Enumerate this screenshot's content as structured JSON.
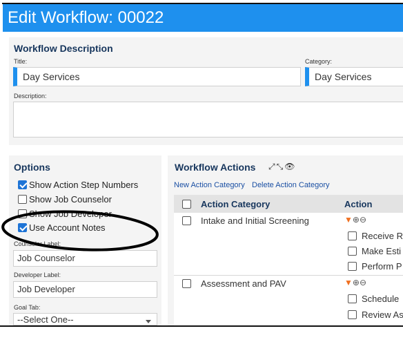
{
  "header": {
    "title": "Edit Workflow: 00022"
  },
  "workflow_description": {
    "heading": "Workflow Description",
    "title_label": "Title:",
    "title_value": "Day Services",
    "category_label": "Category:",
    "category_value": "Day Services",
    "description_label": "Description:",
    "description_value": ""
  },
  "options": {
    "heading": "Options",
    "checkboxes": [
      {
        "label": "Show Action Step Numbers",
        "checked": true
      },
      {
        "label": "Show Job Counselor",
        "checked": false
      },
      {
        "label": "Show Job Developer",
        "checked": false
      },
      {
        "label": "Use Account Notes",
        "checked": true
      }
    ],
    "counselor_label": "Counselor Label:",
    "counselor_value": "Job Counselor",
    "developer_label": "Developer Label:",
    "developer_value": "Job Developer",
    "goal_tab_label": "Goal Tab:",
    "goal_tab_value": "--Select One--"
  },
  "workflow_actions": {
    "heading": "Workflow Actions",
    "icons": [
      "expand-icon",
      "collapse-icon",
      "eye-icon"
    ],
    "links": {
      "new_category": "New Action Category",
      "delete_category": "Delete Action Category"
    },
    "columns": [
      "Action Category",
      "Action"
    ],
    "rows": [
      {
        "category": "Intake and Initial Screening",
        "actions": [
          "Receive R",
          "Make Esti",
          "Perform P"
        ]
      },
      {
        "category": "Assessment and PAV",
        "actions": [
          "Schedule",
          "Review As"
        ]
      }
    ],
    "control_glyphs": {
      "move": "▼",
      "add": "⊕",
      "remove": "⊖"
    }
  },
  "colors": {
    "header_bg": "#1e90ee",
    "heading_text": "#17365d",
    "checkbox_checked": "#1e74d6",
    "link": "#1a4fa3",
    "row_arrow": "#f07020"
  }
}
